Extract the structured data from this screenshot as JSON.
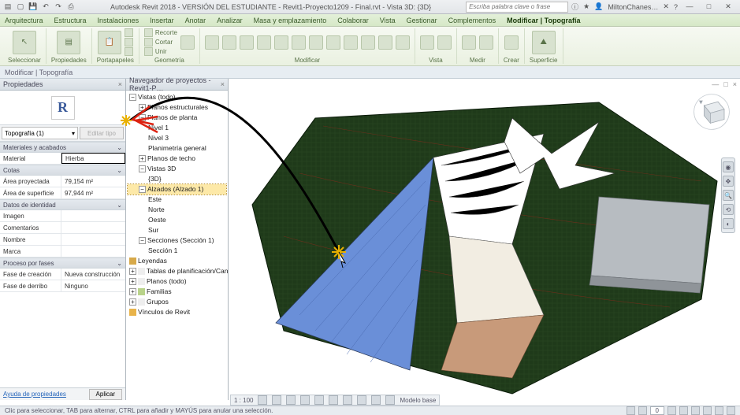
{
  "title_bar": {
    "app_title": "Autodesk Revit 2018 -   VERSIÓN DEL ESTUDIANTE -   Revit1-Proyecto1209 - Final.rvt - Vista 3D: {3D}",
    "search_placeholder": "Escriba palabra clave o frase",
    "user_name": "MiltonChanes…"
  },
  "menus": {
    "items": [
      "Arquitectura",
      "Estructura",
      "Instalaciones",
      "Insertar",
      "Anotar",
      "Analizar",
      "Masa y emplazamiento",
      "Colaborar",
      "Vista",
      "Gestionar",
      "Complementos",
      "Modificar | Topografía"
    ],
    "active_index": 11
  },
  "ribbon": {
    "groups": {
      "seleccionar": "Seleccionar",
      "propiedades": "Propiedades",
      "portapapeles": "Portapapeles",
      "geometria": "Geometría",
      "modificar": "Modificar",
      "vista": "Vista",
      "medir": "Medir",
      "crear": "Crear",
      "superficie": "Superficie"
    },
    "labels": {
      "modificar_btn": "Modificar",
      "pegar": "Pegar",
      "recorte": "Recorte",
      "cortar": "Cortar",
      "unir": "Unir",
      "editar_superficie": "Editar superficie"
    }
  },
  "options_bar": {
    "context": "Modificar | Topografía"
  },
  "properties": {
    "panel_title": "Propiedades",
    "type_selector": "Topografía (1)",
    "edit_type": "Editar tipo",
    "categories": {
      "materiales": "Materiales y acabados",
      "cotas": "Cotas",
      "identidad": "Datos de identidad",
      "fases": "Proceso por fases"
    },
    "rows": {
      "material_k": "Material",
      "material_v": "Hierba",
      "area_proyectada_k": "Área proyectada",
      "area_proyectada_v": "79,154 m²",
      "area_superficie_k": "Área de superficie",
      "area_superficie_v": "97,944 m²",
      "imagen_k": "Imagen",
      "imagen_v": "",
      "comentarios_k": "Comentarios",
      "comentarios_v": "",
      "nombre_k": "Nombre",
      "nombre_v": "",
      "marca_k": "Marca",
      "marca_v": "",
      "fase_creacion_k": "Fase de creación",
      "fase_creacion_v": "Nueva construcción",
      "fase_derribo_k": "Fase de derribo",
      "fase_derribo_v": "Ninguno"
    },
    "help_link": "Ayuda de propiedades",
    "apply": "Aplicar"
  },
  "browser": {
    "panel_title": "Navegador de proyectos - Revit1-P…",
    "nodes": {
      "vistas": "Vistas (todo)",
      "planos_estructurales": "Planos estructurales",
      "planos_planta": "Planos de planta",
      "nivel1": "Nivel 1",
      "nivel3": "Nivel 3",
      "planimetria": "Planimetría general",
      "planos_techo": "Planos de techo",
      "vistas3d": "Vistas 3D",
      "v3d": "{3D}",
      "alzados": "Alzados (Alzado 1)",
      "este": "Este",
      "norte": "Norte",
      "oeste": "Oeste",
      "sur": "Sur",
      "secciones": "Secciones (Sección 1)",
      "seccion1": "Sección 1",
      "leyendas": "Leyendas",
      "tablas": "Tablas de planificación/Cantidades",
      "planos_todo": "Planos (todo)",
      "familias": "Familias",
      "grupos": "Grupos",
      "vinculos": "Vínculos de Revit"
    }
  },
  "view_controls": {
    "scale": "1 : 100",
    "model_display": "Modelo base"
  },
  "status": {
    "hint": "Clic para seleccionar, TAB para alternar, CTRL para añadir y MAYÚS para anular una selección.",
    "selection_count": "0"
  }
}
